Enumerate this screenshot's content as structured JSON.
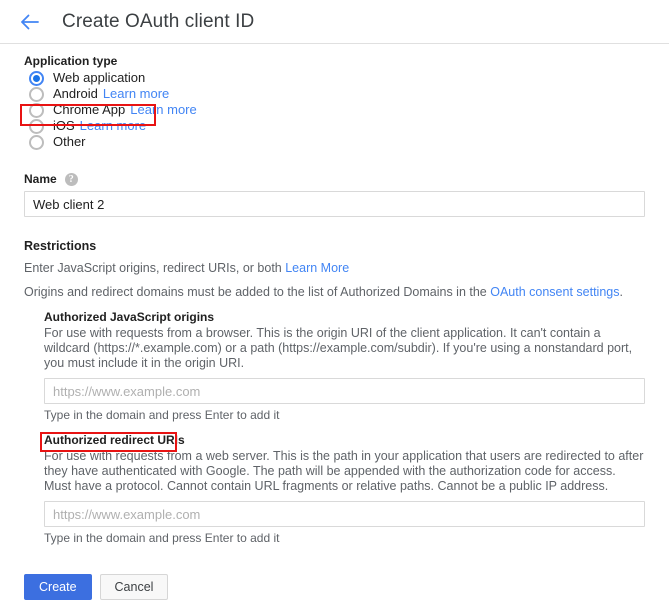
{
  "header": {
    "back_icon": "back-arrow-icon",
    "title": "Create OAuth client ID"
  },
  "application_type": {
    "label": "Application type",
    "options": [
      {
        "label": "Web application",
        "selected": true,
        "learn_more": ""
      },
      {
        "label": "Android",
        "selected": false,
        "learn_more": "Learn more"
      },
      {
        "label": "Chrome App",
        "selected": false,
        "learn_more": "Learn more"
      },
      {
        "label": "iOS",
        "selected": false,
        "learn_more": "Learn more"
      },
      {
        "label": "Other",
        "selected": false,
        "learn_more": ""
      }
    ]
  },
  "name_field": {
    "label": "Name",
    "help_icon": "help-circle-icon",
    "value": "Web client 2",
    "placeholder": ""
  },
  "restrictions": {
    "heading": "Restrictions",
    "line1_text": "Enter JavaScript origins, redirect URIs, or both ",
    "line1_link": "Learn More",
    "line2_text": "Origins and redirect domains must be added to the list of Authorized Domains in the ",
    "line2_link": "OAuth consent settings",
    "line2_suffix": ".",
    "javascript_origins": {
      "title": "Authorized JavaScript origins",
      "description": "For use with requests from a browser. This is the origin URI of the client application. It can't contain a wildcard (https://*.example.com) or a path (https://example.com/subdir). If you're using a nonstandard port, you must include it in the origin URI.",
      "placeholder": "https://www.example.com",
      "value": "",
      "hint": "Type in the domain and press Enter to add it"
    },
    "redirect_uris": {
      "title": "Authorized redirect URIs",
      "description": "For use with requests from a web server. This is the path in your application that users are redirected to after they have authenticated with Google. The path will be appended with the authorization code for access. Must have a protocol. Cannot contain URL fragments or relative paths. Cannot be a public IP address.",
      "placeholder": "https://www.example.com",
      "value": "",
      "hint": "Type in the domain and press Enter to add it"
    }
  },
  "actions": {
    "create_label": "Create",
    "cancel_label": "Cancel"
  },
  "annotations": {
    "highlight_color": "#e81313",
    "boxes": [
      {
        "name": "web-application-option"
      },
      {
        "name": "authorized-redirect-uris-title"
      }
    ]
  },
  "colors": {
    "accent_blue": "#4285f4",
    "primary_button": "#3c6fe0",
    "link_blue": "#4285f4",
    "text_primary": "#212121",
    "text_secondary": "#5f6368"
  }
}
